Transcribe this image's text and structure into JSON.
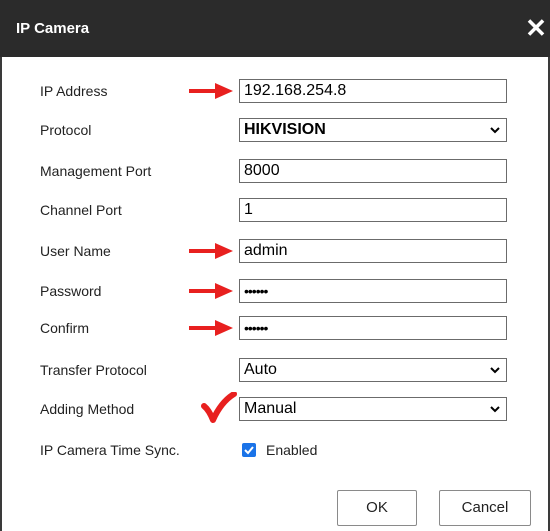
{
  "dialog": {
    "title": "IP Camera",
    "close_glyph": "✕"
  },
  "form": {
    "ip_address": {
      "label": "IP Address",
      "value": "192.168.254.8"
    },
    "protocol": {
      "label": "Protocol",
      "value": "HIKVISION"
    },
    "management_port": {
      "label": "Management Port",
      "value": "8000"
    },
    "channel_port": {
      "label": "Channel Port",
      "value": "1"
    },
    "user_name": {
      "label": "User Name",
      "value": "admin"
    },
    "password": {
      "label": "Password",
      "value": "••••••"
    },
    "confirm": {
      "label": "Confirm",
      "value": "••••••"
    },
    "transfer_protocol": {
      "label": "Transfer Protocol",
      "value": "Auto"
    },
    "adding_method": {
      "label": "Adding Method",
      "value": "Manual"
    },
    "time_sync": {
      "label": "IP Camera Time Sync.",
      "checkbox_label": "Enabled",
      "checked": true
    }
  },
  "buttons": {
    "ok": "OK",
    "cancel": "Cancel"
  },
  "annotations": {
    "arrow_color": "#e8201f",
    "check_color": "#e8201f"
  },
  "colors": {
    "titlebar": "#2b2b2b",
    "checkbox": "#1a73e8"
  }
}
